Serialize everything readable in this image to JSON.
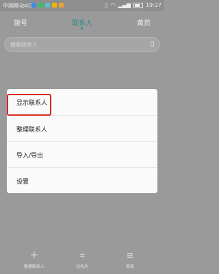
{
  "status": {
    "carrier": "中国移动4G",
    "time": "19:27",
    "notif_colors": [
      "#3a8ee6",
      "#3fbf5f",
      "#5fc0c6",
      "#f2b400",
      "#e6a531"
    ]
  },
  "tabs": [
    {
      "label": "拨号"
    },
    {
      "label": "联系人",
      "active": true
    },
    {
      "label": "黄页"
    }
  ],
  "search": {
    "placeholder": "搜索联系人"
  },
  "menu": {
    "items": [
      {
        "label": "显示联系人",
        "highlighted": true
      },
      {
        "label": "整理联系人"
      },
      {
        "label": "导入/导出"
      },
      {
        "label": "设置"
      }
    ]
  },
  "bottom_bar": {
    "items": [
      {
        "label": "新建联系人",
        "icon": "plus-icon"
      },
      {
        "label": "扫名片",
        "icon": "scan-icon"
      },
      {
        "label": "菜单",
        "icon": "menu-icon"
      }
    ]
  },
  "colors": {
    "accent": "#2b8a86",
    "highlight_border": "#d9281e"
  }
}
